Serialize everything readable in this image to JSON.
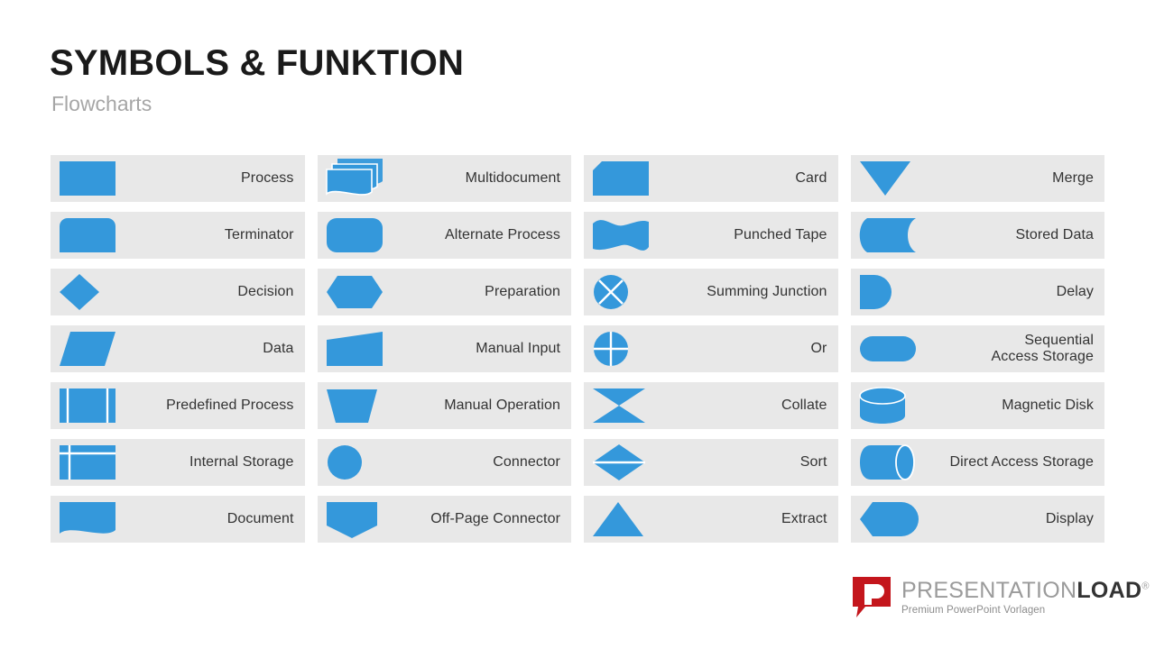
{
  "header": {
    "title": "SYMBOLS & FUNKTION",
    "subtitle": "Flowcharts"
  },
  "theme": {
    "shape_blue": "#3498db",
    "row_background": "#e8e8e8",
    "label_color": "#333333",
    "title_color": "#1a1a1a",
    "subtitle_color": "#a6a6a6",
    "logo_red": "#c4161c"
  },
  "columns": [
    {
      "rows": [
        {
          "label": "Process",
          "shape": "process"
        },
        {
          "label": "Terminator",
          "shape": "terminator"
        },
        {
          "label": "Decision",
          "shape": "decision"
        },
        {
          "label": "Data",
          "shape": "data"
        },
        {
          "label": "Predefined Process",
          "shape": "predefined-process"
        },
        {
          "label": "Internal Storage",
          "shape": "internal-storage"
        },
        {
          "label": "Document",
          "shape": "document"
        }
      ]
    },
    {
      "rows": [
        {
          "label": "Multidocument",
          "shape": "multidocument"
        },
        {
          "label": "Alternate Process",
          "shape": "alternate-process"
        },
        {
          "label": "Preparation",
          "shape": "preparation"
        },
        {
          "label": "Manual Input",
          "shape": "manual-input"
        },
        {
          "label": "Manual Operation",
          "shape": "manual-operation"
        },
        {
          "label": "Connector",
          "shape": "connector"
        },
        {
          "label": "Off-Page Connector",
          "shape": "off-page-connector"
        }
      ]
    },
    {
      "rows": [
        {
          "label": "Card",
          "shape": "card"
        },
        {
          "label": "Punched Tape",
          "shape": "punched-tape"
        },
        {
          "label": "Summing Junction",
          "shape": "summing-junction"
        },
        {
          "label": "Or",
          "shape": "or"
        },
        {
          "label": "Collate",
          "shape": "collate"
        },
        {
          "label": "Sort",
          "shape": "sort"
        },
        {
          "label": "Extract",
          "shape": "extract"
        }
      ]
    },
    {
      "rows": [
        {
          "label": "Merge",
          "shape": "merge"
        },
        {
          "label": "Stored Data",
          "shape": "stored-data"
        },
        {
          "label": "Delay",
          "shape": "delay"
        },
        {
          "label": "Sequential\nAccess Storage",
          "shape": "sequential-access-storage"
        },
        {
          "label": "Magnetic Disk",
          "shape": "magnetic-disk"
        },
        {
          "label": "Direct Access Storage",
          "shape": "direct-access-storage"
        },
        {
          "label": "Display",
          "shape": "display"
        }
      ]
    }
  ],
  "logo": {
    "mark_letter": "P",
    "name_light": "PRESENTATION",
    "name_bold": "LOAD",
    "registered": "®",
    "tagline": "Premium PowerPoint Vorlagen"
  }
}
